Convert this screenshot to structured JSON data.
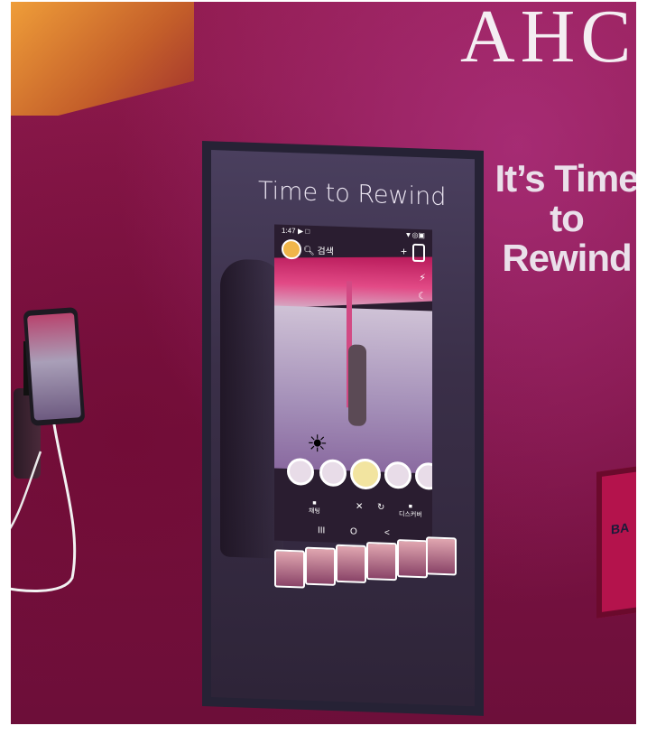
{
  "scene": {
    "wall_brand": "AHC",
    "side_text": [
      "It’s Time",
      "to",
      "Rewind"
    ],
    "card_text": "BA"
  },
  "mirror": {
    "title": "Time to Rewind"
  },
  "screen": {
    "status_time": "1:47",
    "status_icons": "▶ □",
    "status_system": "▼◎▣",
    "search_label": "검색",
    "left_label": "채팅",
    "right_label": "디스커버",
    "nav_recents": "III",
    "nav_home": "O",
    "nav_back": "<"
  },
  "colors": {
    "wall": "#8a1647",
    "accent_pink": "#d24a84",
    "frame": "#262235"
  }
}
